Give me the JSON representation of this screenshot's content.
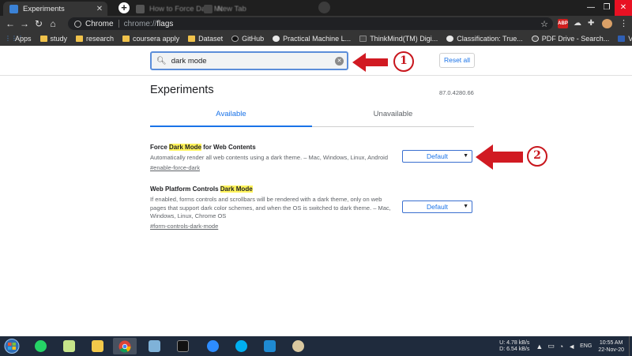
{
  "browser": {
    "tabs": [
      {
        "title": "Experiments",
        "active": true
      },
      {
        "title": "How to Force Dark Mode",
        "active": false
      },
      {
        "title": "New Tab",
        "active": false
      }
    ],
    "new_tab_label": "+",
    "omnibox": {
      "scheme": "Chrome",
      "host": "chrome://",
      "path": "flags"
    },
    "extensions": {
      "abp": "ABP"
    },
    "window_controls": {
      "minimize": "—",
      "maximize": "❐",
      "close": "✕"
    }
  },
  "bookmarks": [
    {
      "label": "Apps",
      "icon": "apps-icon"
    },
    {
      "label": "study",
      "icon": "folder-icon"
    },
    {
      "label": "research",
      "icon": "folder-icon"
    },
    {
      "label": "coursera apply",
      "icon": "folder-icon"
    },
    {
      "label": "Dataset",
      "icon": "folder-icon"
    },
    {
      "label": "GitHub",
      "icon": "github-icon"
    },
    {
      "label": "Practical Machine L...",
      "icon": "globe-icon"
    },
    {
      "label": "ThinkMind(TM) Digi...",
      "icon": "document-icon"
    },
    {
      "label": "Classification: True...",
      "icon": "globe-icon"
    },
    {
      "label": "PDF Drive - Search...",
      "icon": "drive-icon"
    },
    {
      "label": "Vipul Gote",
      "icon": "profile-card-icon"
    }
  ],
  "flags_page": {
    "search": {
      "value": "dark mode"
    },
    "reset_label": "Reset all",
    "title": "Experiments",
    "version": "87.0.4280.66",
    "tabs": {
      "available": "Available",
      "unavailable": "Unavailable"
    },
    "flags": [
      {
        "title_before": "Force ",
        "title_highlight": "Dark Mode",
        "title_after": " for Web Contents",
        "description": "Automatically render all web contents using a dark theme. – Mac, Windows, Linux, Android",
        "link": "#enable-force-dark",
        "value": "Default"
      },
      {
        "title_before": "Web Platform Controls ",
        "title_highlight": "Dark Mode",
        "title_after": "",
        "description": "If enabled, forms controls and scrollbars will be rendered with a dark theme, only on web pages that support dark color schemes, and when the OS is switched to dark theme. – Mac, Windows, Linux, Chrome OS",
        "link": "#form-controls-dark-mode",
        "value": "Default"
      }
    ],
    "annotations": {
      "first": "1",
      "second": "2"
    },
    "annotation_color": "#d11a22",
    "highlight_color": "#fff35c",
    "accent_color": "#1a73e8"
  },
  "taskbar": {
    "net": {
      "up_label": "U:",
      "down_label": "D:",
      "up": "4.78 kB/s",
      "down": "6.54 kB/s"
    },
    "lang": "ENG",
    "time": "10:55 AM",
    "date": "22-Nov-20"
  }
}
